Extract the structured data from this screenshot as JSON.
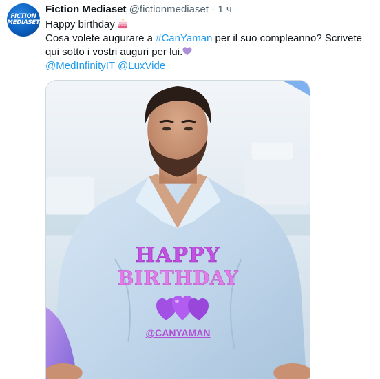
{
  "tweet": {
    "avatar": {
      "line1": "FICTION",
      "line2": "MEDIASET"
    },
    "author_name": "Fiction Mediaset",
    "author_handle": "@fictionmediaset",
    "separator": "·",
    "time": "1 ч",
    "line1_text": "Happy birthday",
    "line2_prefix": "Cosa volete augurare a ",
    "hashtag": "#CanYaman",
    "line2_suffix": " per il suo compleanno? Scrivete qui sotto i vostri auguri per lui.",
    "mention_1": "@MedInfinityIT",
    "mention_space": " ",
    "mention_2": "@LuxVide",
    "emoji_after_birthday": "birthday-cake",
    "emoji_after_text": "purple-heart"
  },
  "media": {
    "overlay_line1": "HAPPY",
    "overlay_line2": "BIRTHDAY",
    "overlay_mention": "@CANYAMAN",
    "overlay_icon": "three-purple-hearts",
    "colors": {
      "happy": "#c44fe0",
      "birthday": "#e27ce8",
      "mention": "#b14fd6",
      "hearts": "#a455e8",
      "shirt": "#c8dcee",
      "sky": "#d9e6ef"
    }
  },
  "colors": {
    "link": "#1d9bf0",
    "secondary_text": "#536471",
    "primary_text": "#0f1419"
  }
}
